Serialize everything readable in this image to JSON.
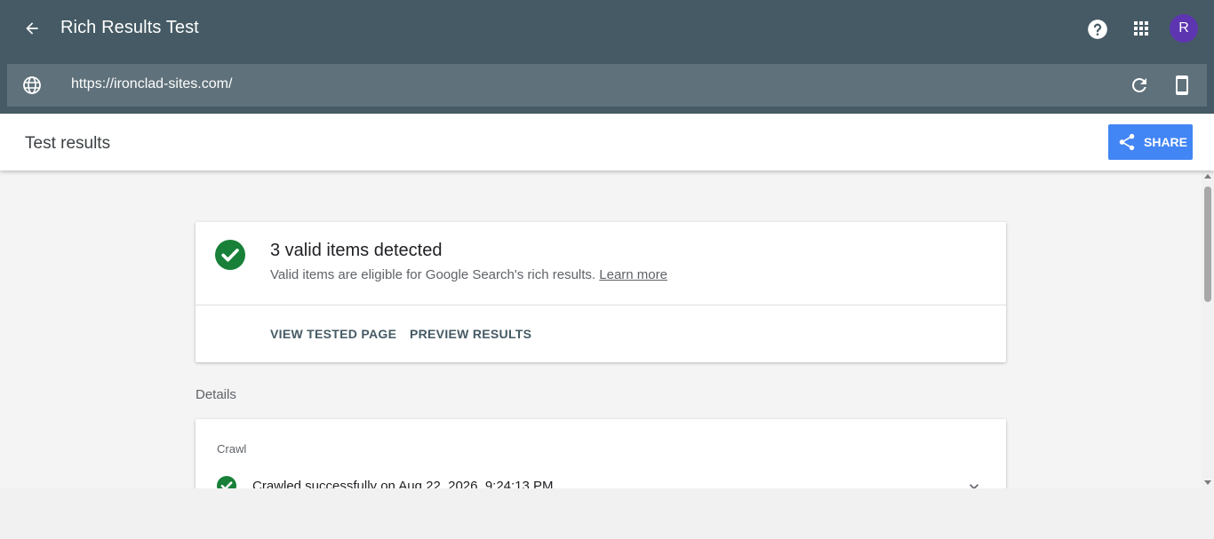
{
  "header": {
    "title": "Rich Results Test",
    "avatar_letter": "R",
    "avatar_color": "#5e35b1",
    "bar_color": "#455a64"
  },
  "urlbar": {
    "url": "https://ironclad-sites.com/"
  },
  "results": {
    "title": "Test results",
    "share_label": "SHARE",
    "share_color": "#4285f4"
  },
  "summary": {
    "title": "3 valid items detected",
    "description": "Valid items are eligible for Google Search's rich results.",
    "learn_more": "Learn more",
    "actions": [
      "VIEW TESTED PAGE",
      "PREVIEW RESULTS"
    ],
    "status_color": "#188038"
  },
  "details": {
    "label": "Details",
    "crawl": {
      "label": "Crawl",
      "status": "Crawled successfully on Aug 22, 2026, 9:24:13 PM"
    }
  }
}
